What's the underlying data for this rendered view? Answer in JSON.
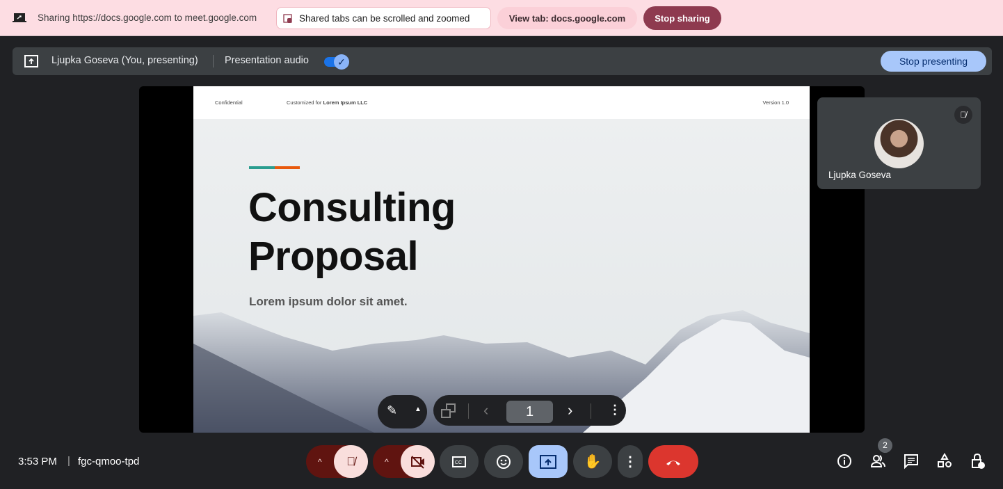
{
  "share_bar": {
    "sharing_text": "Sharing https://docs.google.com to meet.google.com",
    "hint": "Shared tabs can be scrolled and zoomed",
    "view_tab": "View tab: docs.google.com",
    "stop_sharing": "Stop sharing"
  },
  "presenter_bar": {
    "presenter": "Ljupka Goseva (You, presenting)",
    "audio_label": "Presentation audio",
    "audio_enabled": true,
    "stop_presenting": "Stop presenting"
  },
  "slide": {
    "confidential": "Confidential",
    "customized_prefix": "Customized for ",
    "customized_company": "Lorem Ipsum LLC",
    "version": "Version 1.0",
    "title_line1": "Consulting",
    "title_line2": "Proposal",
    "subtitle": "Lorem ipsum dolor sit amet.",
    "accent_colors": [
      "#2a9d8f",
      "#e8590c"
    ]
  },
  "slide_controls": {
    "page": "1"
  },
  "participant": {
    "name": "Ljupka Goseva",
    "muted": true
  },
  "meeting": {
    "time": "3:53 PM",
    "code": "fgc-qmoo-tpd",
    "participants_count": "2"
  },
  "colors": {
    "share_bar": "#fddde3",
    "stop_sharing": "#8e3a4f",
    "stop_presenting": "#a8c7fa",
    "end_call": "#dc362e",
    "muted_bg": "#f9dedc",
    "muted_dark": "#601410"
  }
}
